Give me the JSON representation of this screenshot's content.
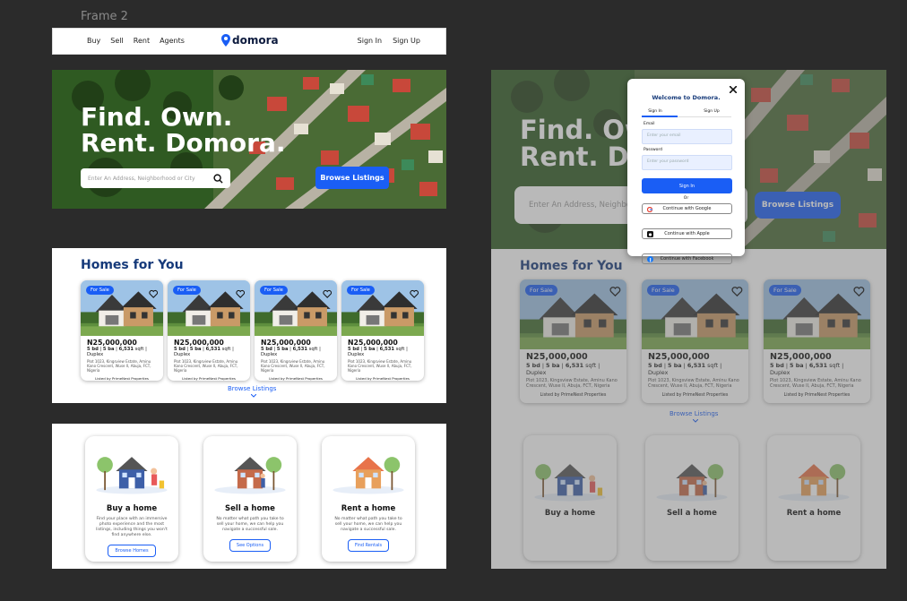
{
  "frame_label": "Frame 2",
  "nav": {
    "links": [
      "Buy",
      "Sell",
      "Rent",
      "Agents"
    ],
    "logo": "domora",
    "sign_in": "Sign In",
    "sign_up": "Sign Up"
  },
  "hero": {
    "line1": "Find. Own.",
    "line2": "Rent. Domora.",
    "search_placeholder": "Enter An Address, Neighborhood or City",
    "browse_button": "Browse Listings"
  },
  "homes": {
    "title": "Homes for You",
    "listings": [
      {
        "badge": "For Sale",
        "price": "N25,000,000",
        "beds": "5 bd",
        "baths": "5 ba",
        "sqft": "6,531",
        "sqft_unit": "sqft",
        "type": "Duplex",
        "address": "Plot 1023, Kingsview Estate, Aminu Kano Crescent, Wuse II, Abuja, FCT, Nigeria",
        "listed_by": "Listed by PrimeNest Properties"
      },
      {
        "badge": "For Sale",
        "price": "N25,000,000",
        "beds": "5 bd",
        "baths": "5 ba",
        "sqft": "6,531",
        "sqft_unit": "sqft",
        "type": "Duplex",
        "address": "Plot 1023, Kingsview Estate, Aminu Kano Crescent, Wuse II, Abuja, FCT, Nigeria",
        "listed_by": "Listed by PrimeNest Properties"
      },
      {
        "badge": "For Sale",
        "price": "N25,000,000",
        "beds": "5 bd",
        "baths": "5 ba",
        "sqft": "6,531",
        "sqft_unit": "sqft",
        "type": "Duplex",
        "address": "Plot 1023, Kingsview Estate, Aminu Kano Crescent, Wuse II, Abuja, FCT, Nigeria",
        "listed_by": "Listed by PrimeNest Properties"
      },
      {
        "badge": "For Sale",
        "price": "N25,000,000",
        "beds": "5 bd",
        "baths": "5 ba",
        "sqft": "6,531",
        "sqft_unit": "sqft",
        "type": "Duplex",
        "address": "Plot 1023, Kingsview Estate, Aminu Kano Crescent, Wuse II, Abuja, FCT, Nigeria",
        "listed_by": "Listed by PrimeNest Properties"
      }
    ],
    "browse_link": "Browse Listings"
  },
  "services": [
    {
      "title": "Buy a home",
      "desc": "Find your place with an immersive photo experience and the most listings, including things you won't find anywhere else.",
      "button": "Browse Homes"
    },
    {
      "title": "Sell a home",
      "desc": "No matter what path you take to sell your home, we can help you navigate a successful sale.",
      "button": "See Options"
    },
    {
      "title": "Rent a home",
      "desc": "No matter what path you take to sell your home, we can help you navigate a successful sale.",
      "button": "Find Rentals"
    }
  ],
  "modal": {
    "title": "Welcome to Domora.",
    "tab_sign_in": "Sign In",
    "tab_sign_up": "Sign Up",
    "email_label": "Email",
    "email_placeholder": "Enter your email",
    "password_label": "Password",
    "password_placeholder": "Enter your password",
    "submit": "Sign In",
    "or": "Or",
    "google": "Continue with Google",
    "apple": "Continue with Apple",
    "facebook": "Continue with Facebook"
  },
  "colors": {
    "accent": "#1a5ef5",
    "heading": "#163a7a",
    "canvas": "#2b2b2b"
  }
}
